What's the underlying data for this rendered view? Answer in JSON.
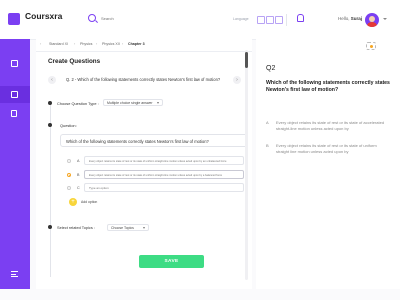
{
  "app": {
    "name": "Coursxra"
  },
  "search": {
    "placeholder": "Search"
  },
  "header": {
    "lang_label": "Language",
    "hello": "Hello,",
    "user": "Suraj"
  },
  "breadcrumb": [
    "Standard XI",
    "Physics",
    "Physics XII",
    "Chapter 3"
  ],
  "main": {
    "title": "Create Questions",
    "question_line": "Q. 2 - Which of the following statements correctly states Newton's first law of motion?",
    "choose_type_label": "Choose Question Type :",
    "question_type": "Multiple choice single answer",
    "question_label": "Question:",
    "question_text": "Which of the following statements correctly states Newton's first law of motion?",
    "options": [
      {
        "letter": "A",
        "text": "Every object retains its state of rest or its state of uniform straight-line motion unless acted upon by an unbalanced force"
      },
      {
        "letter": "B",
        "text": "Every object retains its state of rest or its state of uniform straight-line motion unless acted upon by a balanced force"
      },
      {
        "letter": "C",
        "placeholder": "Type an option"
      }
    ],
    "add_option": "Add option",
    "related_topics_label": "Select related Topics :",
    "topics": "Choose Topics",
    "save": "SAVE"
  },
  "preview": {
    "q_number": "Q2",
    "question": "Which of the following statements correctly states Newton's first law of motion?",
    "options": [
      {
        "letter": "A",
        "text": "Every object retains its state of rest or its state of accelerated straight-line motion unless acted upon by"
      },
      {
        "letter": "B",
        "text": "Every object retains its state of rest or its state of uniform straight line motion unless acted upon by"
      }
    ]
  }
}
